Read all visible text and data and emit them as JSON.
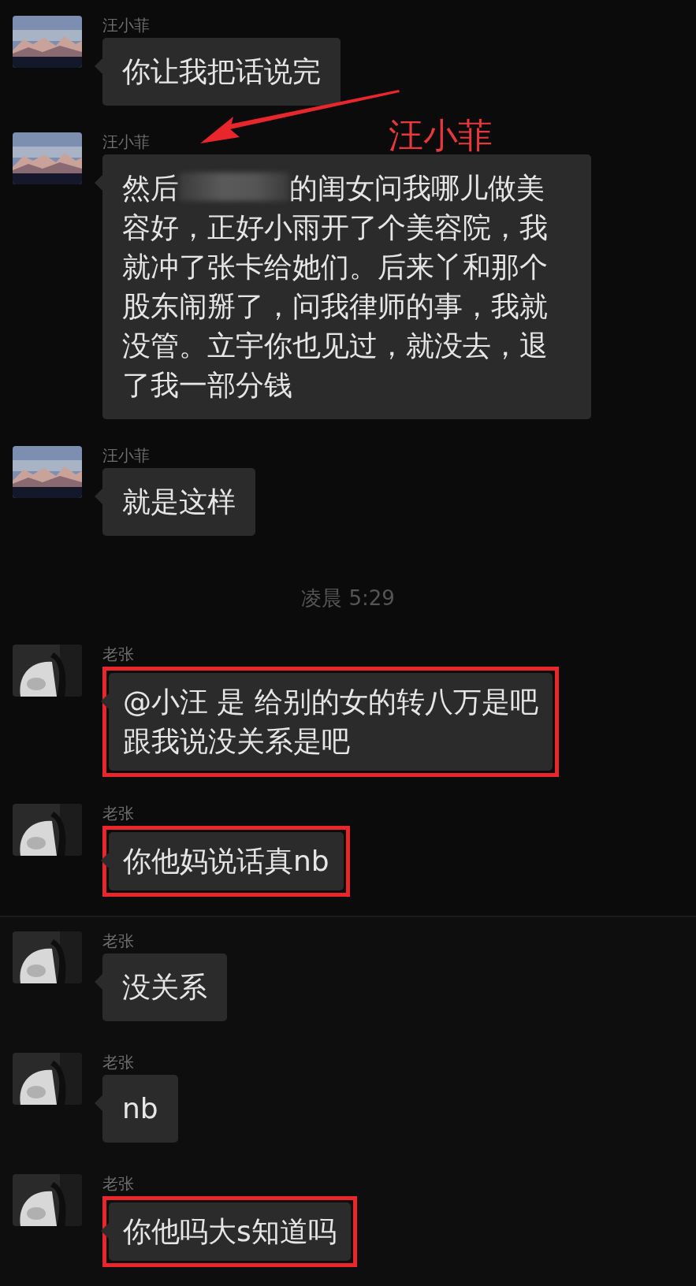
{
  "panels": [
    {
      "items": [
        {
          "kind": "message",
          "sender": "汪小菲",
          "avatar": {
            "kind": "picture",
            "color": "#7d8fb0",
            "scene": true
          },
          "highlighted": false,
          "segments": [
            {
              "kind": "text",
              "text": "你让我把话说完"
            }
          ]
        },
        {
          "kind": "message",
          "sender": "汪小菲",
          "avatar": {
            "kind": "picture",
            "color": "#7d8fb0",
            "scene": true
          },
          "highlighted": false,
          "segments": [
            {
              "kind": "text",
              "text": "然后"
            },
            {
              "kind": "redaction"
            },
            {
              "kind": "text",
              "text": "的闺女问我哪儿做美容好，正好小雨开了个美容院，我就冲了张卡给她们。后来丫和那个股东闹掰了，问我律师的事，我就没管。立宇你也见过，就没去，退了我一部分钱"
            }
          ]
        },
        {
          "kind": "message",
          "sender": "汪小菲",
          "avatar": {
            "kind": "picture",
            "color": "#7d8fb0",
            "scene": true
          },
          "highlighted": false,
          "segments": [
            {
              "kind": "text",
              "text": "就是这样"
            }
          ]
        },
        {
          "kind": "time",
          "text": "凌晨 5:29"
        },
        {
          "kind": "message",
          "sender": "老张",
          "avatar": {
            "kind": "picture",
            "color": "#2a2a2a",
            "scene": false
          },
          "highlighted": true,
          "segments": [
            {
              "kind": "text",
              "text": "@小汪 是 给别的女的转八万是吧"
            },
            {
              "kind": "break"
            },
            {
              "kind": "text",
              "text": "跟我说没关系是吧"
            }
          ]
        },
        {
          "kind": "message",
          "sender": "老张",
          "avatar": {
            "kind": "picture",
            "color": "#2a2a2a",
            "scene": false
          },
          "highlighted": true,
          "segments": [
            {
              "kind": "text",
              "text": "你他妈说话真nb"
            }
          ]
        }
      ]
    },
    {
      "items": [
        {
          "kind": "message",
          "sender": "老张",
          "avatar": {
            "kind": "picture",
            "color": "#2a2a2a",
            "scene": false
          },
          "highlighted": false,
          "segments": [
            {
              "kind": "text",
              "text": "没关系"
            }
          ]
        },
        {
          "kind": "message",
          "sender": "老张",
          "avatar": {
            "kind": "picture",
            "color": "#2a2a2a",
            "scene": false
          },
          "highlighted": false,
          "segments": [
            {
              "kind": "text",
              "text": "nb"
            }
          ]
        },
        {
          "kind": "message",
          "sender": "老张",
          "avatar": {
            "kind": "picture",
            "color": "#2a2a2a",
            "scene": false
          },
          "highlighted": true,
          "segments": [
            {
              "kind": "text",
              "text": "你他吗大s知道吗"
            }
          ]
        }
      ]
    }
  ],
  "annotation": {
    "label": "汪小菲"
  }
}
